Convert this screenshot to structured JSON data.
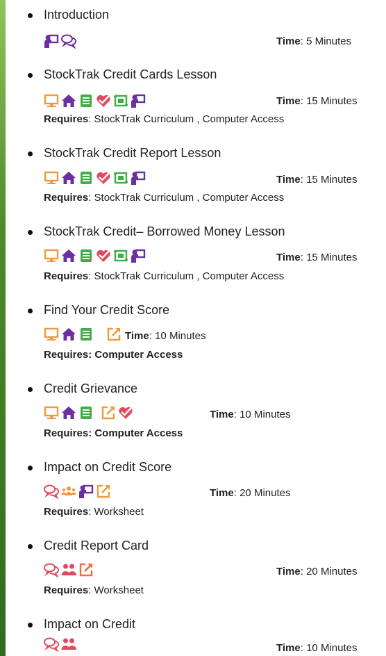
{
  "colors": {
    "purple": "#6b2fa3",
    "orange": "#f29a3a",
    "green": "#3fae49",
    "red": "#e24a5f",
    "coral": "#f06a3e",
    "side_bar": "#4e8a2a"
  },
  "labels": {
    "time": "Time",
    "requires": "Requires"
  },
  "items": [
    {
      "title": "Introduction",
      "icons": [
        "teacher-board-icon",
        "discussion-icon"
      ],
      "time": "5 Minutes",
      "requires": ""
    },
    {
      "title": "StockTrak Credit Cards Lesson",
      "icons": [
        "computer-icon",
        "home-icon",
        "notebook-icon",
        "check-heart-icon",
        "screen-icon",
        "teacher-board-icon"
      ],
      "time": "15 Minutes",
      "requires": "StockTrak Curriculum , Computer Access"
    },
    {
      "title": "StockTrak Credit Report Lesson",
      "icons": [
        "computer-icon",
        "home-icon",
        "notebook-icon",
        "check-heart-icon",
        "screen-icon",
        "teacher-board-icon"
      ],
      "time": "15 Minutes",
      "requires": "StockTrak Curriculum , Computer Access"
    },
    {
      "title": "StockTrak Credit– Borrowed Money Lesson",
      "icons": [
        "computer-icon",
        "home-icon",
        "notebook-icon",
        "check-heart-icon",
        "screen-icon",
        "teacher-board-icon"
      ],
      "time": "15 Minutes",
      "requires": "StockTrak Curriculum , Computer Access"
    },
    {
      "title": "Find Your Credit Score",
      "icons": [
        "computer-icon",
        "home-icon",
        "notebook-icon",
        "external-link-icon"
      ],
      "time": "10 Minutes",
      "requires": "Requires: Computer Access"
    },
    {
      "title": "Credit Grievance",
      "icons": [
        "computer-icon",
        "home-icon",
        "notebook-icon",
        "external-link-icon",
        "check-heart-icon"
      ],
      "time": "10 Minutes",
      "requires": "Requires: Computer Access"
    },
    {
      "title": "Impact on Credit Score",
      "icons": [
        "discussion-icon",
        "group-icon",
        "teacher-board-icon",
        "external-link-icon"
      ],
      "time": "20 Minutes",
      "requires": "Worksheet"
    },
    {
      "title": "Credit Report Card",
      "icons": [
        "discussion-icon",
        "pair-icon",
        "external-link-icon"
      ],
      "time": "20 Minutes",
      "requires": "Worksheet"
    },
    {
      "title": "Impact on Credit",
      "icons": [
        "discussion-icon",
        "pair-icon"
      ],
      "time": "10 Minutes",
      "requires": ""
    }
  ]
}
